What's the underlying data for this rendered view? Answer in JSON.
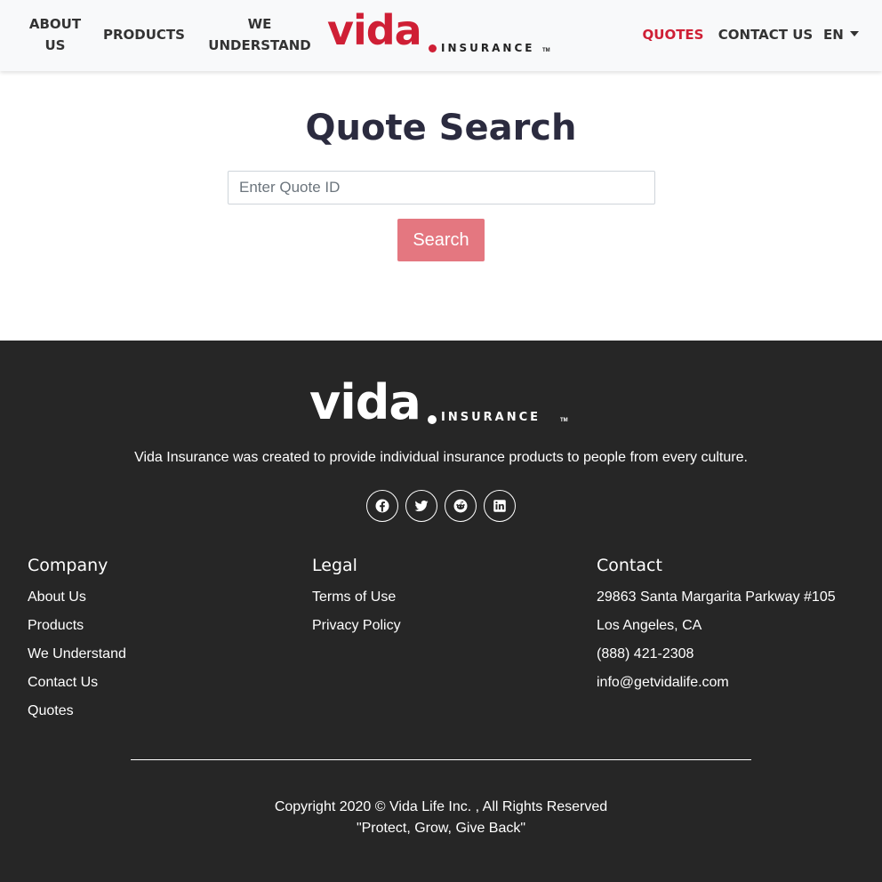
{
  "header": {
    "nav": {
      "about": "ABOUT US",
      "products": "PRODUCTS",
      "understand": "WE UNDERSTAND",
      "quotes": "QUOTES",
      "contact": "CONTACT US",
      "language": "EN"
    },
    "logo": {
      "word": "vida",
      "sub": "INSURANCE",
      "tm": "TM"
    },
    "active_color": "#cf1f35"
  },
  "main": {
    "title": "Quote Search",
    "search_placeholder": "Enter Quote ID",
    "search_value": "",
    "search_button": "Search",
    "button_color": "#e47780"
  },
  "footer": {
    "logo": {
      "word": "vida",
      "sub": "INSURANCE",
      "tm": "TM"
    },
    "tagline": "Vida Insurance was created to provide individual insurance products to people from every culture.",
    "social_icons": [
      "facebook-icon",
      "twitter-icon",
      "reddit-icon",
      "linkedin-icon"
    ],
    "company": {
      "title": "Company",
      "items": [
        "About Us",
        "Products",
        "We Understand",
        "Contact Us",
        "Quotes"
      ]
    },
    "legal": {
      "title": "Legal",
      "items": [
        "Terms of Use",
        "Privacy Policy"
      ]
    },
    "contact": {
      "title": "Contact",
      "items": [
        "29863 Santa Margarita Parkway #105",
        "Los Angeles, CA",
        "(888) 421-2308",
        "info@getvidalife.com"
      ]
    },
    "copyright": "Copyright 2020 © Vida Life Inc. , All Rights Reserved",
    "motto": "\"Protect, Grow, Give Back\"",
    "background": "#262626"
  }
}
